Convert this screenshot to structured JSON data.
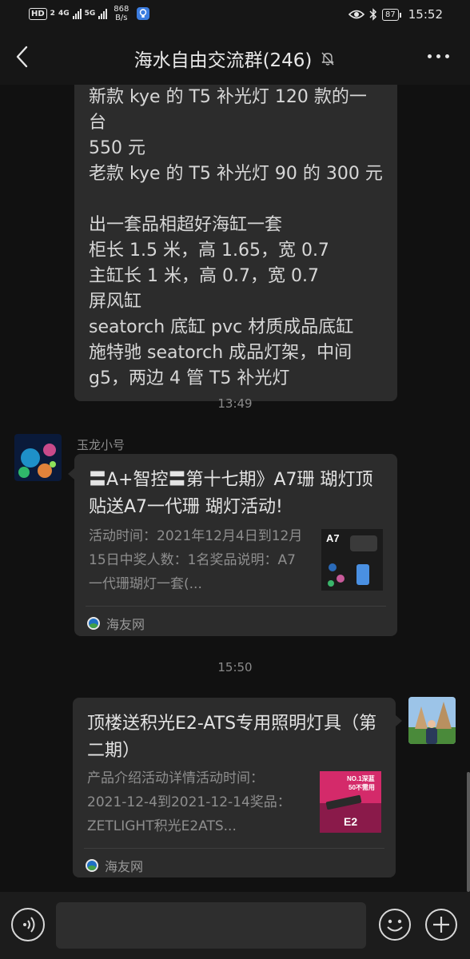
{
  "status_bar": {
    "hd": "HD",
    "sim": "2",
    "net1": "4G",
    "net2": "5G",
    "speed_value": "868",
    "speed_unit": "B/s",
    "battery": "87",
    "time": "15:52"
  },
  "header": {
    "title": "海水自由交流群(246)"
  },
  "messages": {
    "text_bubble": {
      "lines": [
        "新款 kye 的 T5 补光灯 120 款的一台",
        "550 元",
        "老款 kye 的 T5 补光灯 90 的 300 元",
        "",
        "出一套品相超好海缸一套",
        "柜长 1.5 米，高 1.65，宽 0.7",
        "主缸长 1 米，高 0.7，宽 0.7",
        "屏风缸",
        "seatorch 底缸 pvc 材质成品底缸",
        "施特驰 seatorch 成品灯架，中间",
        "g5，两边 4 管 T5 补光灯"
      ]
    },
    "time_1": "13:49",
    "sender_1": "玉龙小号",
    "card_1": {
      "title": "〓A+智控〓第十七期》A7珊 瑚灯顶贴送A7一代珊 瑚灯活动!",
      "desc": "活动时间：2021年12月4日到12月15日中奖人数：1名奖品说明：A7一代珊瑚灯一套(...",
      "thumb_text": "A7",
      "source": "海友网"
    },
    "time_2": "15:50",
    "card_2": {
      "title": "顶楼送积光E2-ATS专用照明灯具（第二期）",
      "desc": "产品介绍活动详情活动时间：2021-12-4到2021-12-14奖品：ZETLIGHT积光E2ATS...",
      "thumb_text_top": "NO.1深蓝",
      "thumb_text_mid": "50不需用",
      "thumb_text_bottom": "E2",
      "source": "海友网"
    }
  },
  "colors": {
    "background": "#111111",
    "bubble": "#2c2c2c",
    "bar": "#161616"
  },
  "icons": [
    "back-arrow-icon",
    "mute-bell-icon",
    "more-dots-icon",
    "voice-icon",
    "emoji-icon",
    "plus-icon"
  ]
}
